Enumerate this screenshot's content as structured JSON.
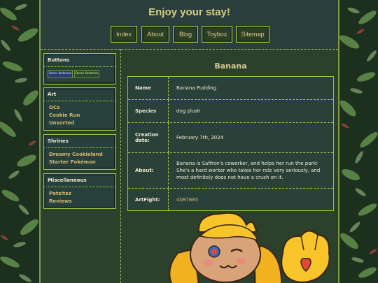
{
  "colors": {
    "accent_border": "#9cc93e",
    "title_gold": "#d5cc84",
    "link_gold": "#d5b86c",
    "panel_teal": "#2a3f3b",
    "panel_green": "#2b412c"
  },
  "header": {
    "title": "Enjoy your stay!",
    "nav": [
      {
        "label": "Index"
      },
      {
        "label": "About"
      },
      {
        "label": "Blog"
      },
      {
        "label": "Toybox"
      },
      {
        "label": "Sitemap"
      }
    ]
  },
  "sidebar": {
    "buttons": {
      "heading": "Buttons",
      "badges": [
        {
          "text": "Beans Kodamaz"
        },
        {
          "text": "Beans Kodamaz"
        }
      ]
    },
    "art": {
      "heading": "Art",
      "items": [
        {
          "label": "OCs"
        },
        {
          "label": "Cookie Run"
        },
        {
          "label": "Unsorted"
        }
      ]
    },
    "shrines": {
      "heading": "Shrines",
      "items": [
        {
          "label": "Dreamy Cookieland"
        },
        {
          "label": "Starter Pokémon"
        }
      ]
    },
    "misc": {
      "heading": "Miscellaneous",
      "items": [
        {
          "label": "Petsites"
        },
        {
          "label": "Reviews"
        }
      ]
    }
  },
  "main": {
    "title": "Banana",
    "rows": [
      {
        "label": "Name",
        "value": "Banana Pudding"
      },
      {
        "label": "Species",
        "value": "dog plush"
      },
      {
        "label": "Creation date:",
        "value": "February 7th, 2024"
      },
      {
        "label": "About:",
        "value": "Banana is Saffron's coworker, and helps her run the park! She's a hard worker who takes her role very seriously, and most definitely does not have a crush on it."
      },
      {
        "label": "ArtFight:",
        "value": "4087685"
      }
    ]
  },
  "icons": {
    "character": "banana-dog-plush-illustration",
    "decor": "jungle-leaves-pattern"
  }
}
